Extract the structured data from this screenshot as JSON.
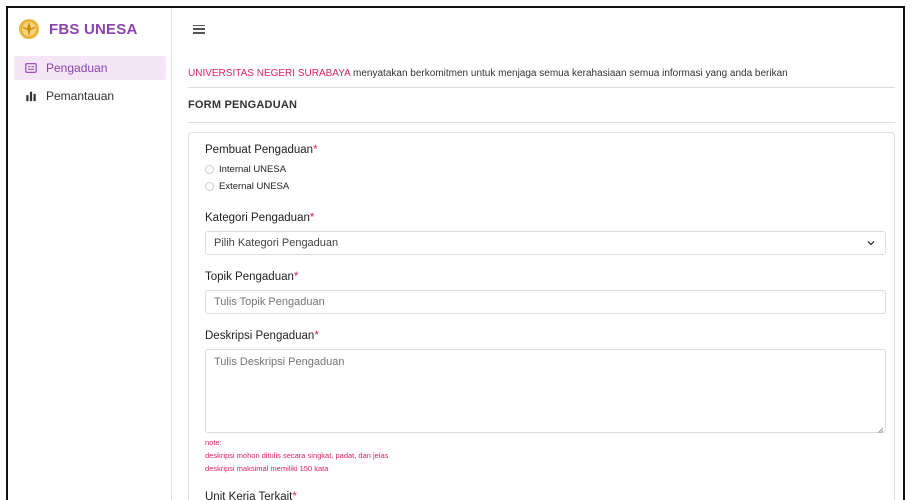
{
  "sidebar": {
    "brand": "FBS UNESA",
    "items": [
      {
        "label": "Pengaduan",
        "icon": "form-icon",
        "active": true
      },
      {
        "label": "Pemantauan",
        "icon": "bar-chart-icon",
        "active": false
      }
    ]
  },
  "colors": {
    "accent": "#8e44ad",
    "active_bg": "#f4e6f7",
    "required": "#e0245e"
  },
  "notice": {
    "org": "UNIVERSITAS NEGERI SURABAYA",
    "text": " menyatakan berkomitmen untuk menjaga semua kerahasiaan semua informasi yang anda berikan"
  },
  "form": {
    "title": "FORM PENGADUAN",
    "pembuat": {
      "label": "Pembuat Pengaduan",
      "options": [
        "Internal UNESA",
        "External UNESA"
      ]
    },
    "kategori": {
      "label": "Kategori Pengaduan",
      "placeholder": "Pilih Kategori Pengaduan"
    },
    "topik": {
      "label": "Topik Pengaduan",
      "placeholder": "Tulis Topik Pengaduan"
    },
    "deskripsi": {
      "label": "Deskripsi Pengaduan",
      "placeholder": "Tulis Deskripsi Pengaduan",
      "notes": [
        "note:",
        "deskripsi mohon ditulis secara singkat, padat, dan jelas",
        "deskripsi maksimal memiliki 150 kata"
      ]
    },
    "unit": {
      "label": "Unit Kerja Terkait"
    },
    "required_mark": "*"
  }
}
